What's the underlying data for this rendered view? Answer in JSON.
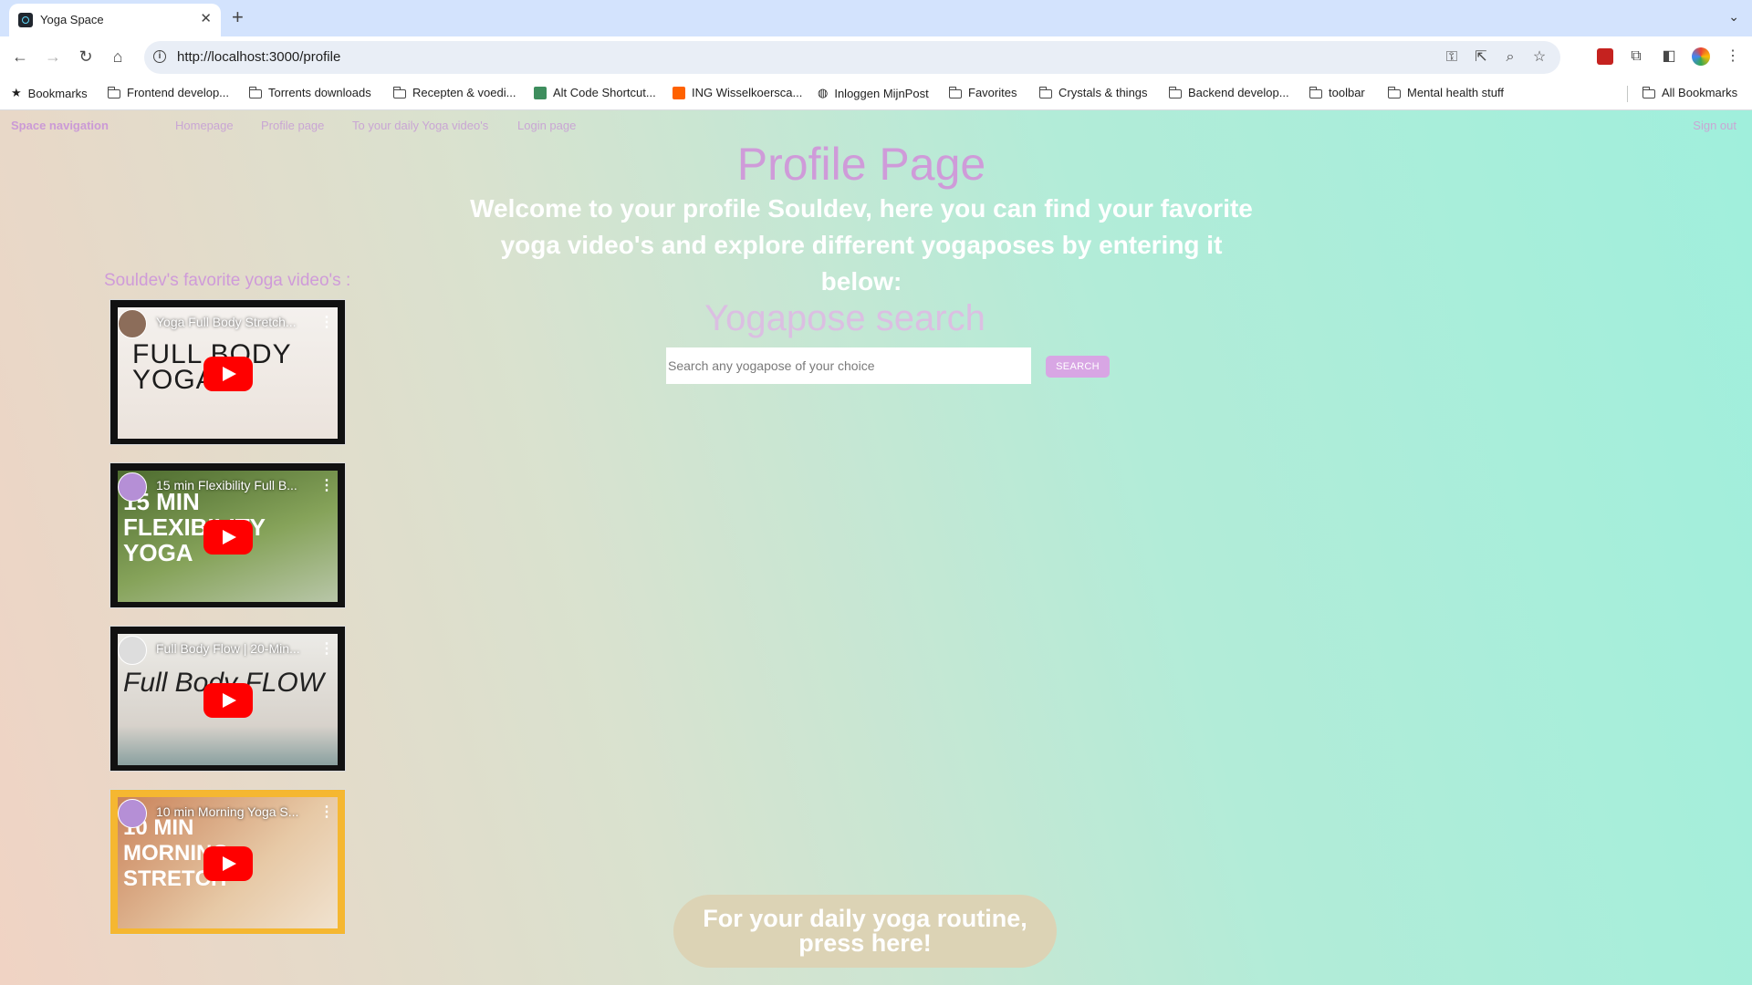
{
  "browser": {
    "tab_title": "Yoga Space",
    "tab_close": "✕",
    "new_tab": "+",
    "url": "http://localhost:3000/profile",
    "bookmarks": [
      {
        "label": "Bookmarks",
        "icon": "star-icon"
      },
      {
        "label": "Frontend develop...",
        "icon": "folder-icon"
      },
      {
        "label": "Torrents downloads",
        "icon": "folder-icon"
      },
      {
        "label": "Recepten & voedi...",
        "icon": "folder-icon"
      },
      {
        "label": "Alt Code Shortcut...",
        "icon": "site-favicon"
      },
      {
        "label": "ING Wisselkoersca...",
        "icon": "site-favicon"
      },
      {
        "label": "Inloggen MijnPost",
        "icon": "globe-icon"
      },
      {
        "label": "Favorites",
        "icon": "folder-icon"
      },
      {
        "label": "Crystals & things",
        "icon": "folder-icon"
      },
      {
        "label": "Backend develop...",
        "icon": "folder-icon"
      },
      {
        "label": "toolbar",
        "icon": "folder-icon"
      },
      {
        "label": "Mental health stuff",
        "icon": "folder-icon"
      }
    ],
    "all_bookmarks": "All Bookmarks"
  },
  "site": {
    "brand": "Space navigation",
    "nav": [
      "Homepage",
      "Profile page",
      "To your daily Yoga video's",
      "Login page"
    ],
    "sign_out": "Sign out",
    "accent_color": "#cf9bd9"
  },
  "profile": {
    "title": "Profile Page",
    "welcome": "Welcome to your profile Souldev, here you can find your favorite yoga video's and explore different yogaposes by entering it below:",
    "favorites_heading": "Souldev's favorite yoga video's :",
    "videos": [
      {
        "title": "Yoga Full Body Stretch...",
        "thumb_text": "FULL BODY YOGA"
      },
      {
        "title": "15 min Flexibility Full B...",
        "thumb_text": "15 MIN FLEXIBILITY YOGA"
      },
      {
        "title": "Full Body Flow | 20-Min...",
        "thumb_text": "Full Body FLOW"
      },
      {
        "title": "10 min Morning Yoga S...",
        "thumb_text": "10 MIN MORNING STRETCH"
      }
    ]
  },
  "search": {
    "title": "Yogapose search",
    "placeholder": "Search any yogapose of your choice",
    "button": "SEARCH"
  },
  "routine_button": "For your daily yoga routine, press here!"
}
